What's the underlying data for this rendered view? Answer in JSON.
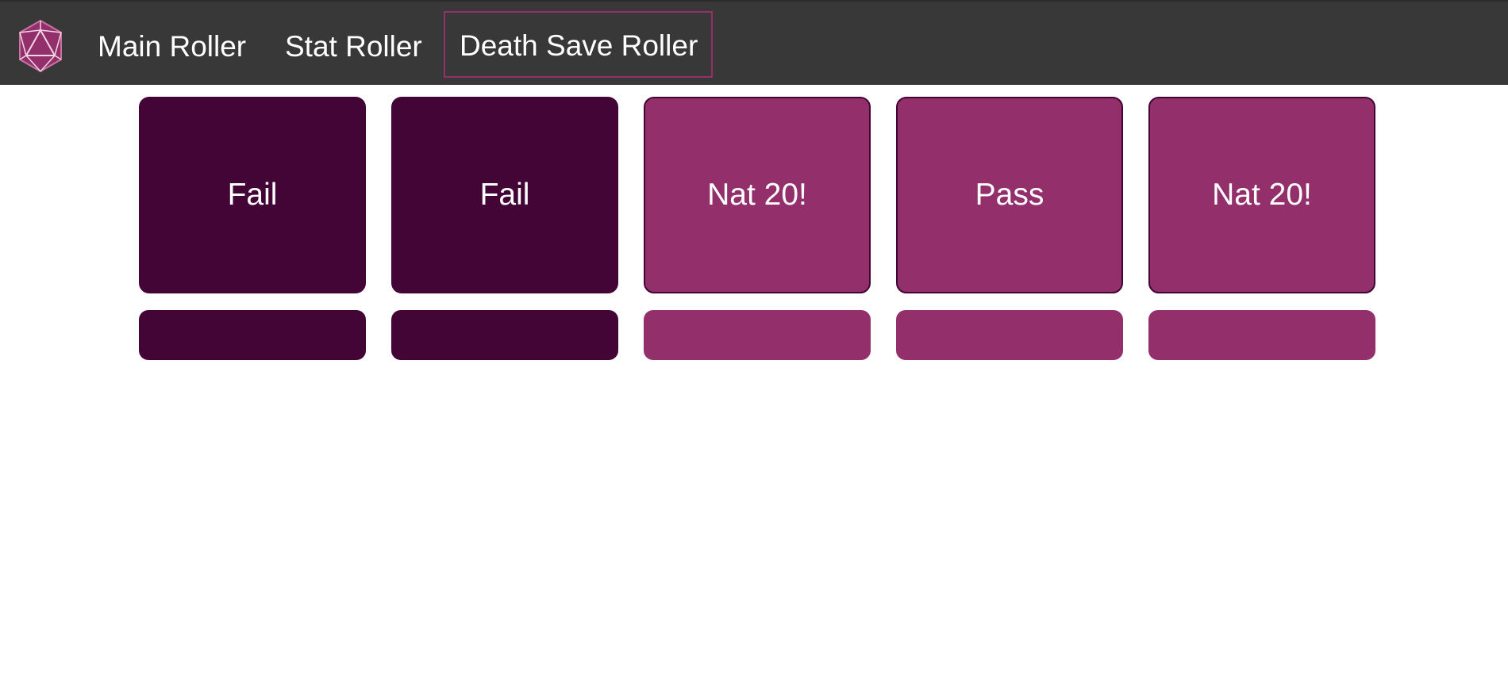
{
  "nav": {
    "logo_icon": "d20-icon",
    "links": [
      {
        "label": "Main Roller",
        "active": false
      },
      {
        "label": "Stat Roller",
        "active": false
      },
      {
        "label": "Death Save Roller",
        "active": true
      }
    ]
  },
  "rolls": [
    {
      "result": "Fail",
      "outcome": "fail"
    },
    {
      "result": "Fail",
      "outcome": "fail"
    },
    {
      "result": "Nat 20!",
      "outcome": "pass"
    },
    {
      "result": "Pass",
      "outcome": "pass"
    },
    {
      "result": "Nat 20!",
      "outcome": "pass"
    }
  ],
  "colors": {
    "navbar": "#383838",
    "fail": "#420536",
    "pass": "#932f6b",
    "active_border": "#93306a"
  }
}
